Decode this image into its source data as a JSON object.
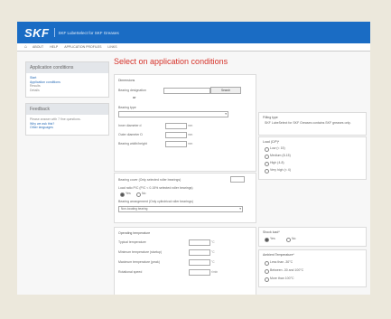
{
  "header": {
    "logo": "SKF",
    "app_title": "SKF LubeSelect for SKF Greases"
  },
  "nav": {
    "home_icon": "home-icon",
    "items": [
      "About",
      "Help",
      "Application profiles",
      "Links"
    ]
  },
  "sidebar": {
    "panel1": {
      "title": "Application conditions",
      "links": [
        "Start",
        "Application conditions",
        "Results",
        "Details"
      ]
    },
    "panel2": {
      "title": "Feedback",
      "lines": [
        "Please answer with 7 fine questions.",
        "Why we ask this?",
        "Other languages"
      ]
    }
  },
  "main": {
    "title": "Select on application conditions",
    "dimensions": {
      "label": "Dimensions",
      "bearing_designation": "Bearing designation",
      "search_btn": "Search",
      "or": "or",
      "bearing_type": "Bearing type",
      "inner_diameter": "Inner diameter d",
      "outer_diameter": "Outer diameter D",
      "bearing_width": "Bearing width/height",
      "unit_mm": "mm",
      "unit_mm_alt": "mm"
    },
    "options": {
      "line1": "Bearing cover (Only selected roller bearings)",
      "line2": "Load ratio P/C (P/C < 0.15% selected roller bearings)",
      "yes": "Yes",
      "no": "No",
      "line3": "Bearing arrangement (Only cylindrical roller bearings)",
      "select_placeholder": "Non-locating bearing"
    },
    "operating": {
      "label": "Operating temperature",
      "typical": "Typical temperature",
      "minimum": "Minimum temperature (startup)",
      "maximum": "Maximum temperature (peak)",
      "rotational": "Rotational speed",
      "unit_c": "°C",
      "unit_rpm": "r/min"
    },
    "right": {
      "filling_title": "Filling type",
      "filling_text": "SKF LubeSelect for SKF Greases contains SKF greases only.",
      "load_title": "Load (C/P)*",
      "load_options": [
        "Low (< 15)",
        "Medium (8-15)",
        "High (4-8)",
        "Very high (< 4)"
      ],
      "shock_title": "Shock load*",
      "shock_yes": "Yes",
      "shock_no": "No",
      "ambient_title": "Ambient Temperature*",
      "ambient_options": [
        "Less than -30°C",
        "Between -30 and 100°C",
        "More than 100°C"
      ]
    }
  }
}
